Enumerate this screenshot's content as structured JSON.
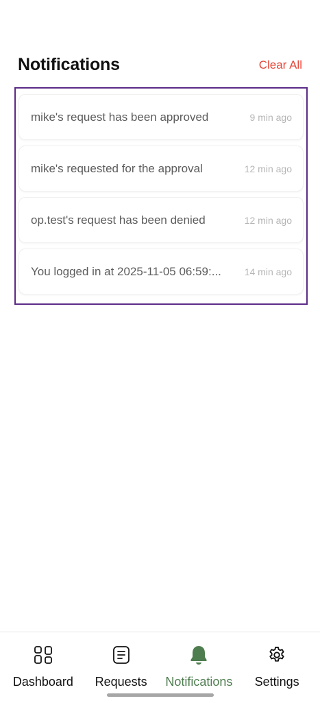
{
  "header": {
    "title": "Notifications",
    "clear_all_label": "Clear All"
  },
  "notifications": [
    {
      "message": "mike's request has been approved",
      "time": "9 min ago"
    },
    {
      "message": "mike's requested for the approval",
      "time": "12 min ago"
    },
    {
      "message": "op.test's request has been denied",
      "time": "12 min ago"
    },
    {
      "message": "You logged in at 2025-11-05 06:59:...",
      "time": "14 min ago"
    }
  ],
  "tabbar": {
    "tabs": [
      {
        "label": "Dashboard",
        "icon": "grid-icon",
        "active": false
      },
      {
        "label": "Requests",
        "icon": "document-icon",
        "active": false
      },
      {
        "label": "Notifications",
        "icon": "bell-icon",
        "active": true
      },
      {
        "label": "Settings",
        "icon": "gear-icon",
        "active": false
      }
    ]
  },
  "colors": {
    "accent_active": "#4e7d4f",
    "clear_all": "#e5483b",
    "focus_border": "#5b2a86"
  }
}
